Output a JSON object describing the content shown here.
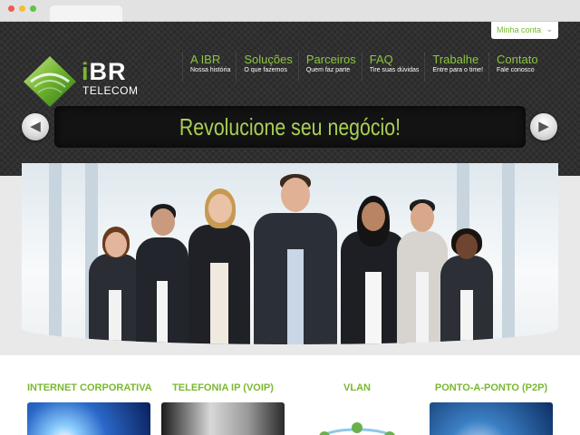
{
  "brand": {
    "name_i": "i",
    "name_rest": "BR",
    "tagline": "TELECOM"
  },
  "account": {
    "label": "Minha conta",
    "chevron": "chevron-down-icon"
  },
  "nav": [
    {
      "title": "A IBR",
      "sub": "Nossa história"
    },
    {
      "title": "Soluções",
      "sub": "O que fazemos"
    },
    {
      "title": "Parceiros",
      "sub": "Quem faz parte"
    },
    {
      "title": "FAQ",
      "sub": "Tire suas dúvidas"
    },
    {
      "title": "Trabalhe",
      "sub": "Entre para o time!"
    },
    {
      "title": "Contato",
      "sub": "Fale conosco"
    }
  ],
  "slider": {
    "headline": "Revolucione seu negócio!",
    "prev_icon": "arrow-left-icon",
    "next_icon": "arrow-right-icon"
  },
  "services": [
    {
      "title": "INTERNET CORPORATIVA"
    },
    {
      "title": "TELEFONIA IP (VOIP)"
    },
    {
      "title": "VLAN"
    },
    {
      "title": "PONTO-A-PONTO (P2P)"
    }
  ],
  "colors": {
    "accent": "#7ab830",
    "header_bg": "#2a2a2a",
    "banner_text": "#a9cf55"
  }
}
